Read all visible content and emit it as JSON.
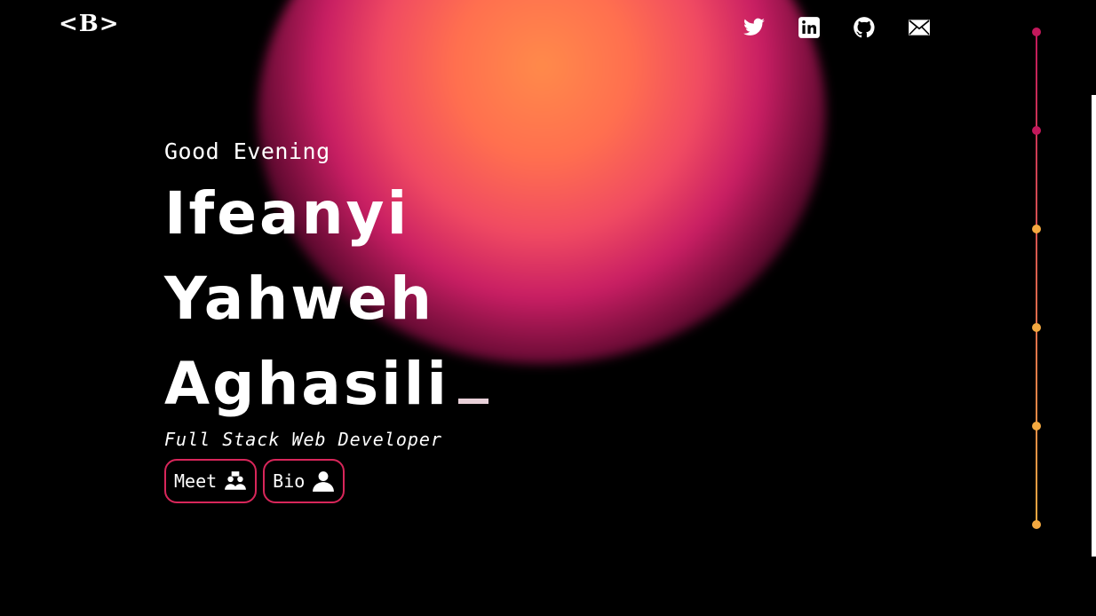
{
  "logo": {
    "text": "<B>"
  },
  "social": [
    {
      "name": "twitter-icon"
    },
    {
      "name": "linkedin-icon"
    },
    {
      "name": "github-icon"
    },
    {
      "name": "mail-icon"
    }
  ],
  "hero": {
    "greeting": "Good Evening",
    "name": "Ifeanyi Yahweh Aghasili",
    "role": "Full Stack Web Developer"
  },
  "buttons": {
    "meet_label": "Meet",
    "bio_label": "Bio"
  },
  "timeline": {
    "dot_count": 6,
    "colors": [
      "#c2185b",
      "#c2185b",
      "#f4a940",
      "#f4a940",
      "#f4a940",
      "#f4a940"
    ]
  },
  "colors": {
    "accent": "#d8265a",
    "background": "#000000"
  }
}
